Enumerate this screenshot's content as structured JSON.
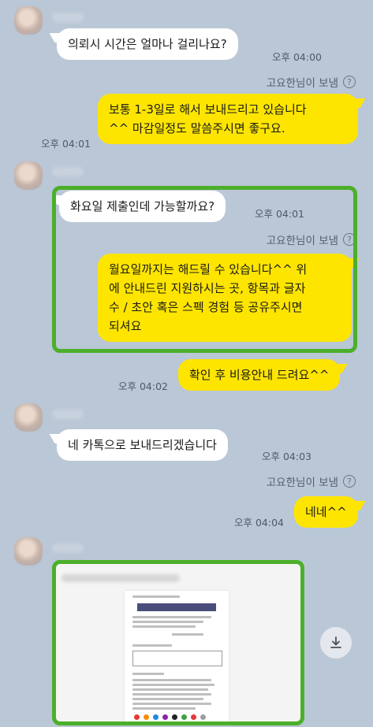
{
  "sent_note": "고요한님이 보냄",
  "help_glyph": "?",
  "messages": [
    {
      "text": "의뢰시 시간은 얼마나 걸리나요?",
      "time": "오후 04:00"
    },
    {
      "text": "보통 1-3일로 해서 보내드리고 있습니다\n^^ 마감일정도 말씀주시면 좋구요.",
      "time": "오후 04:01"
    },
    {
      "text": "화요일 제출인데 가능할까요?",
      "time": "오후 04:01"
    },
    {
      "text": "월요일까지는 해드릴 수 있습니다^^ 위\n에 안내드린 지원하시는 곳, 항목과 글자\n수 / 초안 혹은 스펙 경험 등 공유주시면\n되셔요"
    },
    {
      "text": "확인 후 비용안내 드려요^^",
      "time": "오후 04:02"
    },
    {
      "text": "네 카톡으로 보내드리겠습니다",
      "time": "오후 04:03"
    },
    {
      "text": "네네^^",
      "time": "오후 04:04"
    }
  ],
  "download_icon": "download-icon",
  "colors": {
    "background": "#bac7d6",
    "outgoing": "#fee500",
    "incoming": "#ffffff",
    "highlight": "#4caf2a"
  }
}
